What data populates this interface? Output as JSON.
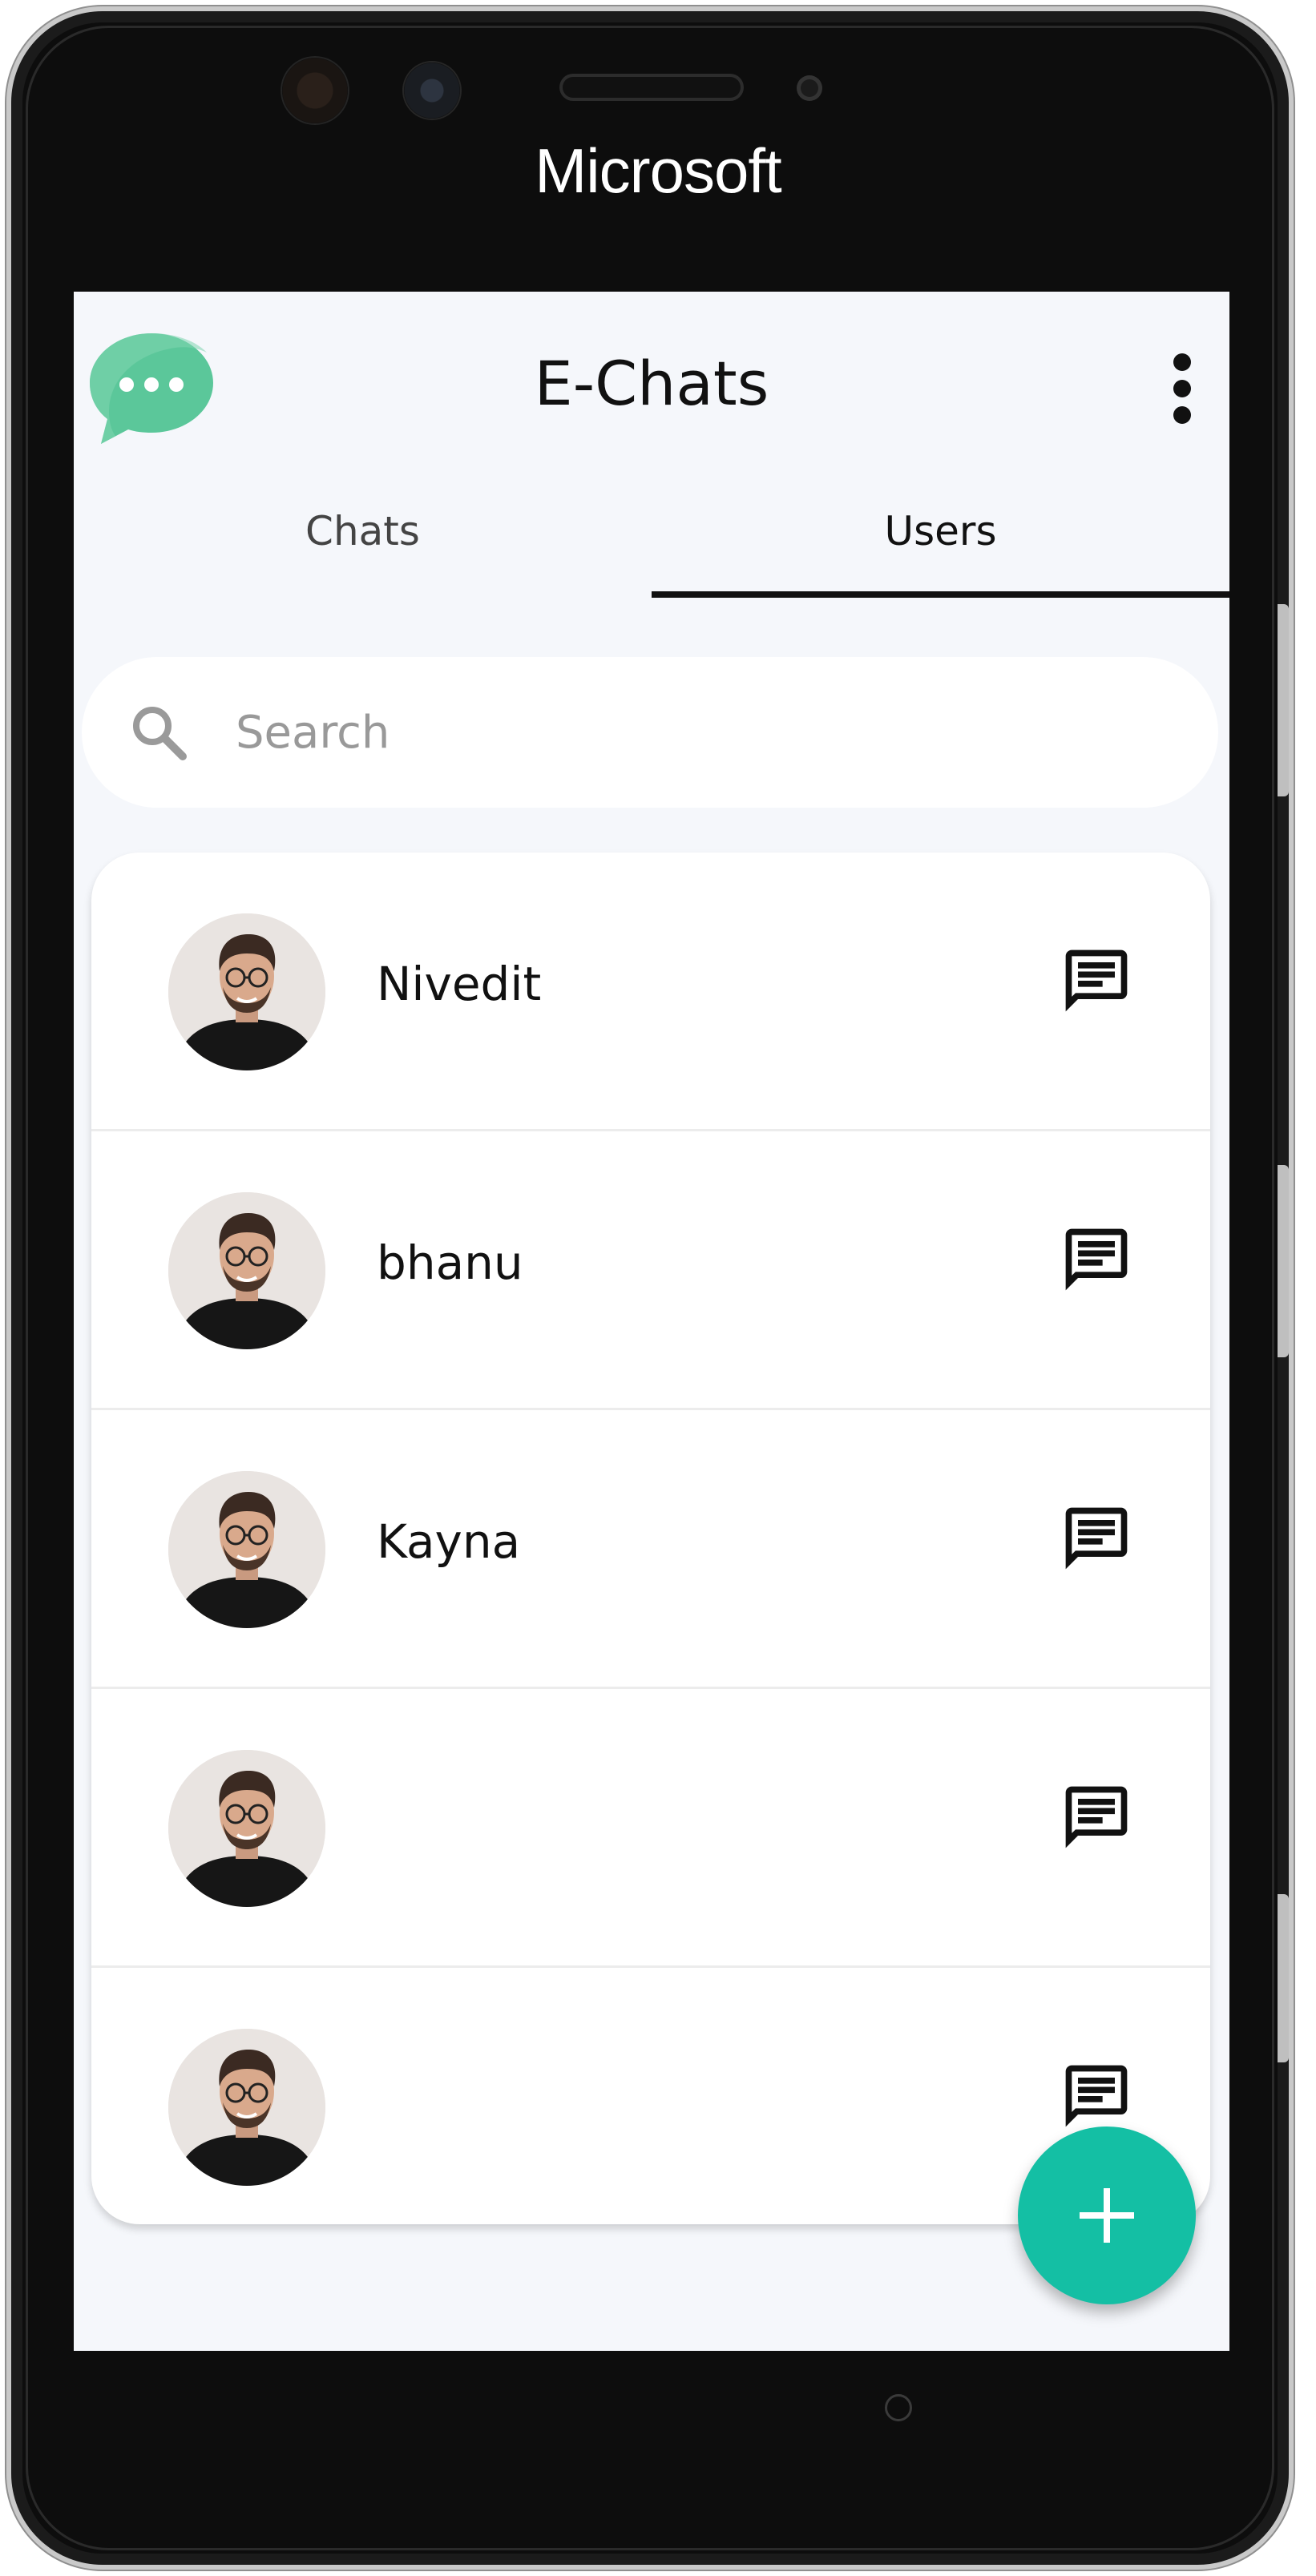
{
  "device": {
    "brand": "Microsoft"
  },
  "appbar": {
    "title": "E-Chats",
    "logo_icon": "chat-bubble-dots-icon",
    "menu_icon": "more-vertical-icon"
  },
  "tabs": [
    {
      "label": "Chats",
      "active": false
    },
    {
      "label": "Users",
      "active": true
    }
  ],
  "search": {
    "placeholder": "Search",
    "value": "",
    "icon": "search-icon"
  },
  "users": [
    {
      "name": "Nivedit",
      "action_icon": "message-icon"
    },
    {
      "name": "bhanu",
      "action_icon": "message-icon"
    },
    {
      "name": "Kayna",
      "action_icon": "message-icon"
    },
    {
      "name": "",
      "action_icon": "message-icon"
    },
    {
      "name": "",
      "action_icon": "message-icon"
    }
  ],
  "fab": {
    "icon": "plus-icon"
  },
  "colors": {
    "accent": "#14bfa4",
    "logo_green": "#5bc79a",
    "background": "#f5f7fb",
    "card": "#ffffff",
    "text": "#111111"
  }
}
